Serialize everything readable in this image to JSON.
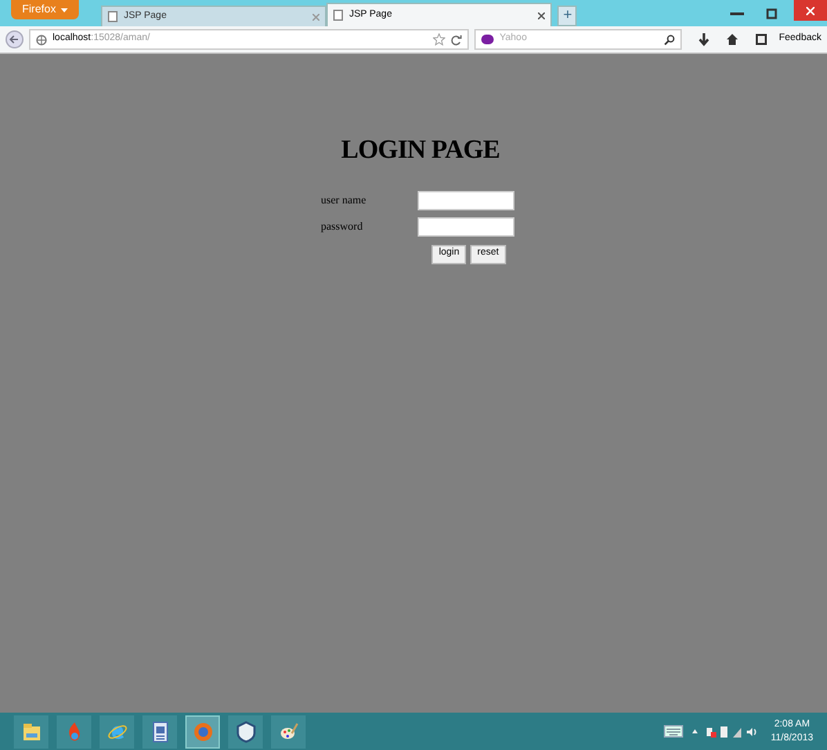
{
  "browser": {
    "menu_button": "Firefox",
    "tabs": [
      {
        "title": "JSP Page",
        "selected": false
      },
      {
        "title": "JSP Page",
        "selected": true
      }
    ],
    "new_tab": "+",
    "url_host": "localhost",
    "url_path": ":15028/aman/",
    "search_placeholder": "Yahoo",
    "toolbar_button": "Feedback"
  },
  "page": {
    "heading": "LOGIN PAGE",
    "fields": [
      {
        "label": "user name"
      },
      {
        "label": "password"
      }
    ],
    "buttons": [
      "login",
      "reset"
    ]
  },
  "taskbar": {
    "apps": [
      {
        "kind": "folder",
        "selected": false
      },
      {
        "kind": "flame",
        "selected": false
      },
      {
        "kind": "ie",
        "selected": false
      },
      {
        "kind": "doc",
        "selected": false
      },
      {
        "kind": "firefox",
        "selected": true
      },
      {
        "kind": "shield",
        "selected": false
      },
      {
        "kind": "paint",
        "selected": false
      }
    ],
    "time": "2:08 AM",
    "date": "11/8/2013"
  }
}
